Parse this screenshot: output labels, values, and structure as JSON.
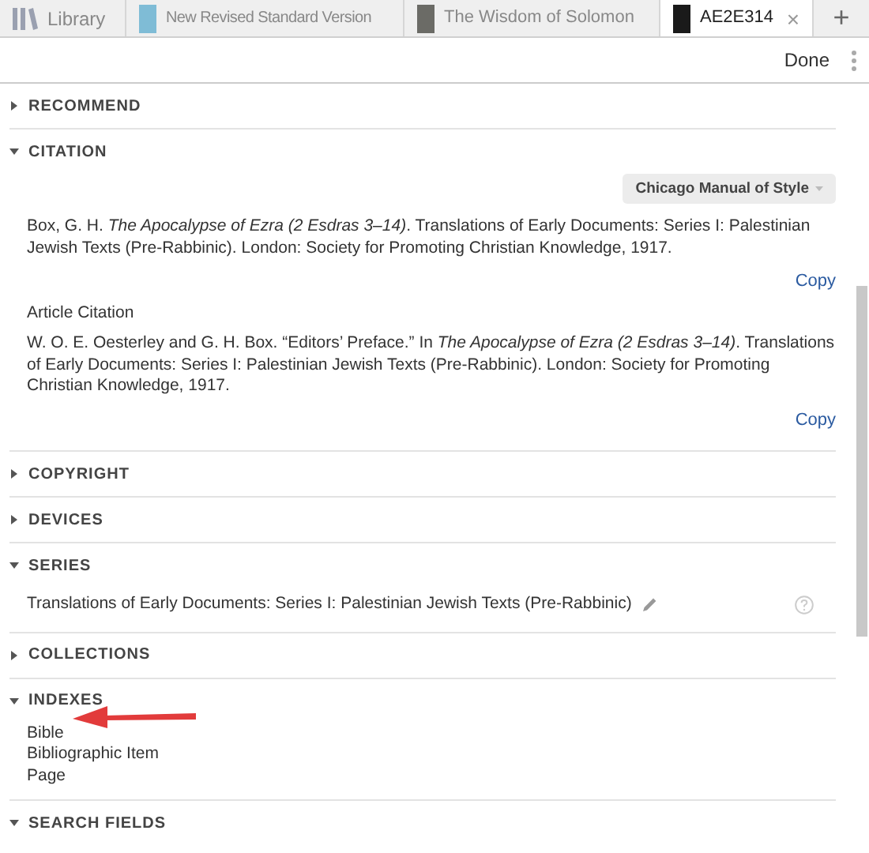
{
  "tabs": [
    {
      "kind": "library",
      "label": "Library",
      "selected": false
    },
    {
      "kind": "book",
      "label": "New Revised Standard Version",
      "selected": false,
      "color": "#7fbcd6"
    },
    {
      "kind": "book",
      "label": "The Wisdom of Solomon",
      "selected": false,
      "color": "#6b6b66"
    },
    {
      "kind": "book",
      "label": "AE2E314",
      "selected": true,
      "color": "#1a1a1a",
      "close": "×"
    }
  ],
  "new_tab": "+",
  "toolbar": {
    "done": "Done"
  },
  "sections": [
    {
      "kind": "plain",
      "title": "RECOMMEND",
      "expanded": false
    },
    {
      "kind": "citation",
      "title": "CITATION",
      "expanded": true,
      "style": "Chicago Manual of Style",
      "citations": [
        {
          "text": "Box, G. H. *The Apocalypse of Ezra (2 Esdras 3–14)*. Translations of Early Documents: Series I: Palestinian Jewish Texts (Pre-Rabbinic). London: Society for Promoting Christian Knowledge, 1917.",
          "copy": "Copy"
        },
        {
          "label": "Article Citation",
          "text": "W. O. E. Oesterley and G. H. Box. “Editors’ Preface.” In *The Apocalypse of Ezra (2 Esdras 3–14)*. Translations of Early Documents: Series I: Palestinian Jewish Texts (Pre-Rabbinic). London: Society for Promoting Christian Knowledge, 1917.",
          "copy": "Copy"
        }
      ]
    },
    {
      "kind": "plain",
      "title": "COPYRIGHT",
      "expanded": false
    },
    {
      "kind": "plain",
      "title": "DEVICES",
      "expanded": false
    },
    {
      "kind": "series",
      "title": "SERIES",
      "expanded": true,
      "value": "Translations of Early Documents: Series I: Palestinian Jewish Texts (Pre-Rabbinic)"
    },
    {
      "kind": "plain",
      "title": "COLLECTIONS",
      "expanded": false
    },
    {
      "kind": "list",
      "title": "INDEXES",
      "expanded": true,
      "items": [
        "Bible",
        "Bibliographic Item",
        "Page"
      ]
    },
    {
      "kind": "plain",
      "title": "SEARCH FIELDS",
      "expanded": true
    }
  ]
}
